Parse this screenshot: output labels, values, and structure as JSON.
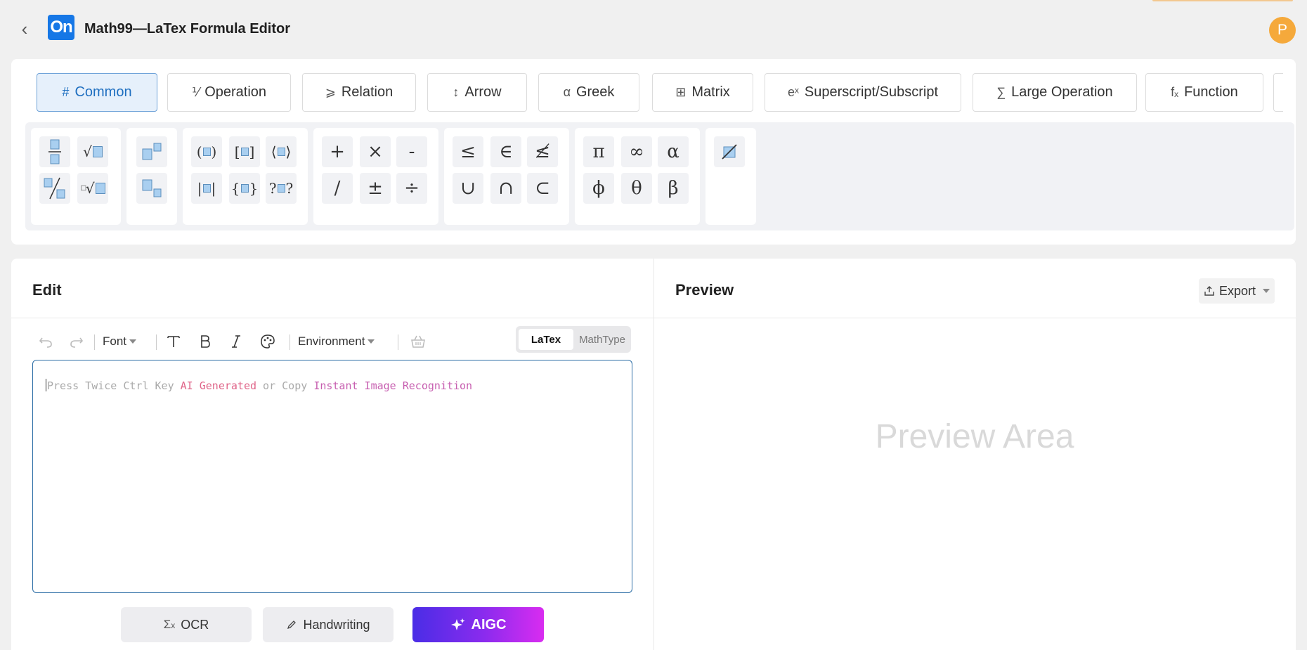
{
  "header": {
    "back_icon": "chevron-left-icon",
    "logo_text": "On",
    "title": "Math99—LaTex Formula Editor",
    "avatar_letter": "P"
  },
  "categories": [
    {
      "label": "Common",
      "icon": "#",
      "active": true
    },
    {
      "label": "Operation",
      "icon": "⅟"
    },
    {
      "label": "Relation",
      "icon": "⩾"
    },
    {
      "label": "Arrow",
      "icon": "↕"
    },
    {
      "label": "Greek",
      "icon": "α"
    },
    {
      "label": "Matrix",
      "icon": "⊞"
    },
    {
      "label": "Superscript/Subscript",
      "icon": "eˣ"
    },
    {
      "label": "Large Operation",
      "icon": "∑"
    },
    {
      "label": "Function",
      "icon": "fₓ"
    }
  ],
  "symbols": {
    "operators": [
      "+",
      "×",
      "-",
      "/",
      "±",
      "÷"
    ],
    "relations": [
      "≤",
      "∈",
      "≰",
      "∪",
      "∩",
      "⊂"
    ],
    "greek": [
      "π",
      "∞",
      "α",
      "ϕ",
      "θ",
      "β"
    ],
    "misc": [
      "∅"
    ]
  },
  "edit": {
    "title": "Edit",
    "font_label": "Font",
    "environment_label": "Environment",
    "mode_latex": "LaTex",
    "mode_mathtype": "MathType",
    "placeholder_prefix": "Press Twice Ctrl Key ",
    "placeholder_ai": "AI Generated",
    "placeholder_or": " or Copy ",
    "placeholder_ocr": "Instant Image Recognition",
    "btn_ocr": "OCR",
    "btn_handwriting": "Handwriting",
    "btn_aigc": "AIGC"
  },
  "preview": {
    "title": "Preview",
    "export_label": "Export",
    "placeholder": "Preview Area"
  },
  "colors": {
    "accent": "#1677e6",
    "active_tab_bg": "#e6f0fb",
    "avatar": "#f5a93b",
    "aigc_start": "#4a2de6",
    "aigc_end": "#d92cf0"
  }
}
